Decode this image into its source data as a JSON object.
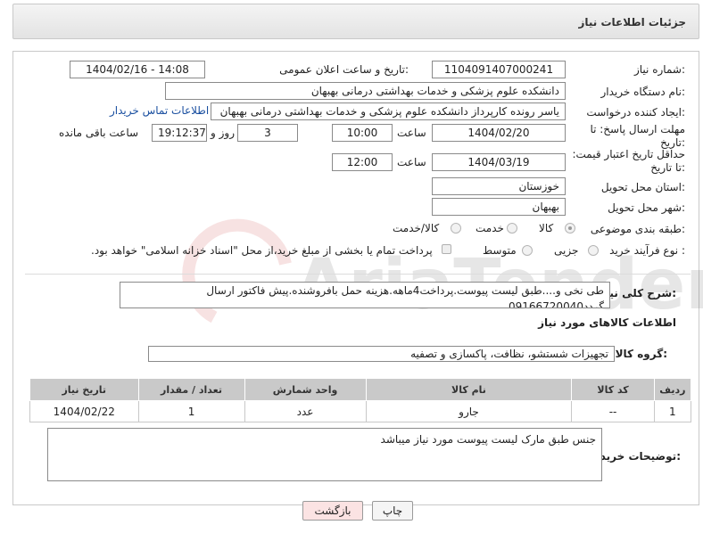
{
  "header": {
    "title": "جزئیات اطلاعات نیاز"
  },
  "need": {
    "number_label": "شماره نیاز:",
    "number_value": "1104091407000241",
    "announce_label": "تاریخ و ساعت اعلان عمومی:",
    "announce_value": "1404/02/16 - 14:08"
  },
  "buyer": {
    "label": "نام دستگاه خریدار:",
    "value": "دانشکده علوم پزشکی و خدمات بهداشتی  درمانی بهبهان"
  },
  "creator": {
    "label": "ایجاد کننده درخواست:",
    "value": "یاسر رونده کارپرداز دانشکده علوم پزشکی و خدمات بهداشتی  درمانی بهبهان",
    "contact_link": "اطلاعات تماس خریدار"
  },
  "deadline": {
    "label": "مهلت ارسال پاسخ: تا تاریخ:",
    "date": "1404/02/20",
    "time_label": "ساعت",
    "time": "10:00",
    "days": "3",
    "days_label": "روز و",
    "remaining": "19:12:37",
    "remaining_label": "ساعت باقی مانده"
  },
  "price_validity": {
    "label": "حداقل تاریخ اعتبار قیمت: تا تاریخ:",
    "date": "1404/03/19",
    "time_label": "ساعت",
    "time": "12:00"
  },
  "province": {
    "label": "استان محل تحویل:",
    "value": "خوزستان"
  },
  "city": {
    "label": "شهر محل تحویل:",
    "value": "بهبهان"
  },
  "category": {
    "label": "طبقه بندی موضوعی:",
    "options": [
      "کالا",
      "خدمت",
      "کالا/خدمت"
    ],
    "selected": "کالا"
  },
  "purchase": {
    "label": "نوع فرآیند خرید :",
    "options": [
      "جزیی",
      "متوسط"
    ],
    "note": "پرداخت تمام یا بخشی از مبلغ خرید،از محل \"اسناد خزانه اسلامی\" خواهد بود."
  },
  "description": {
    "label": "شرح کلی نیاز:",
    "value": "طی نخی و....طبق لیست پیوست.پرداخت4ماهه.هزینه حمل بافروشنده.پیش فاکتور ارسال گردد09166720040"
  },
  "goods_section": {
    "title": "اطلاعات کالاهای مورد نیاز"
  },
  "goods_group": {
    "label": "گروه کالا:",
    "value": "تجهیزات شستشو، نظافت، پاکسازی و تصفیه"
  },
  "table": {
    "headers": [
      "ردیف",
      "کد کالا",
      "نام کالا",
      "واحد شمارش",
      "تعداد / مقدار",
      "تاریخ نیاز"
    ],
    "rows": [
      [
        "1",
        "--",
        "جارو",
        "عدد",
        "1",
        "1404/02/22"
      ]
    ]
  },
  "buyer_notes": {
    "label": "توضیحات خریدار:",
    "value": "جنس طبق مارک لیست پیوست مورد نیاز میباشد"
  },
  "buttons": {
    "print": "چاپ",
    "back": "بازگشت"
  },
  "watermark": {
    "text": "AriaTender.net"
  },
  "colors": {
    "link": "#1a4fa0",
    "table_header": "#c9c9c9",
    "back_button": "#fbe3e3"
  }
}
